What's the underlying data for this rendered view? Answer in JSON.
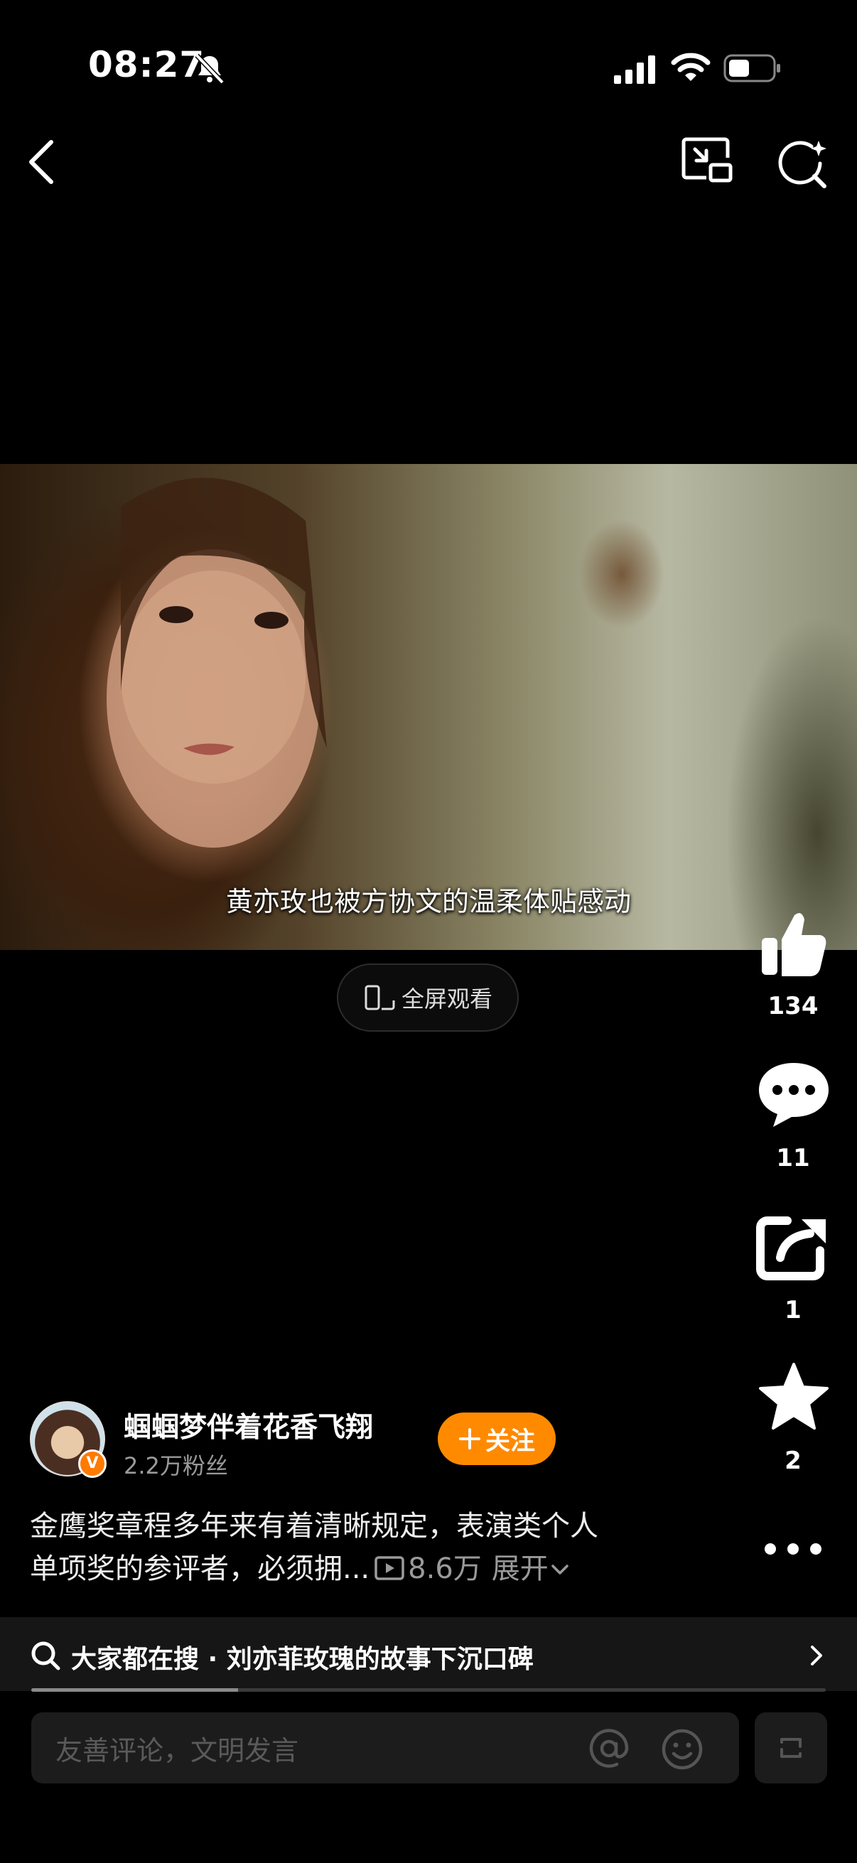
{
  "status_bar": {
    "time": "08:27"
  },
  "video": {
    "subtitle": "黄亦玫也被方协文的温柔体贴感动",
    "fullscreen_label": "全屏观看"
  },
  "actions": {
    "like_count": "134",
    "comment_count": "11",
    "share_count": "1",
    "favorite_count": "2"
  },
  "author": {
    "name": "蝈蝈梦伴着花香飞翔",
    "followers": "2.2万粉丝",
    "verified_badge": "V",
    "follow_label": "关注"
  },
  "description": {
    "line1": "金鹰奖章程多年来有着清晰规定，表演类个人",
    "line2": "单项奖的参评者，必须拥...",
    "play_count": "8.6万",
    "expand_label": "展开"
  },
  "hot_search": {
    "text": "大家都在搜 · 刘亦菲玫瑰的故事下沉口碑",
    "progress": 0.26
  },
  "comment_bar": {
    "placeholder": "友善评论，文明发言"
  },
  "colors": {
    "background": "#000000",
    "accent_orange": "#ff8a00",
    "muted_text": "#9a9a9a",
    "input_bg": "#1c1c1c"
  },
  "icons": [
    "bell-muted-icon",
    "signal-icon",
    "wifi-icon",
    "battery-icon",
    "back-icon",
    "pip-icon",
    "ai-search-icon",
    "phone-rotate-icon",
    "like-icon",
    "comment-icon",
    "share-icon",
    "favorite-icon",
    "more-icon",
    "play-icon",
    "chevron-down-icon",
    "search-icon",
    "chevron-right-icon",
    "at-icon",
    "emoji-icon",
    "expand-icon"
  ]
}
